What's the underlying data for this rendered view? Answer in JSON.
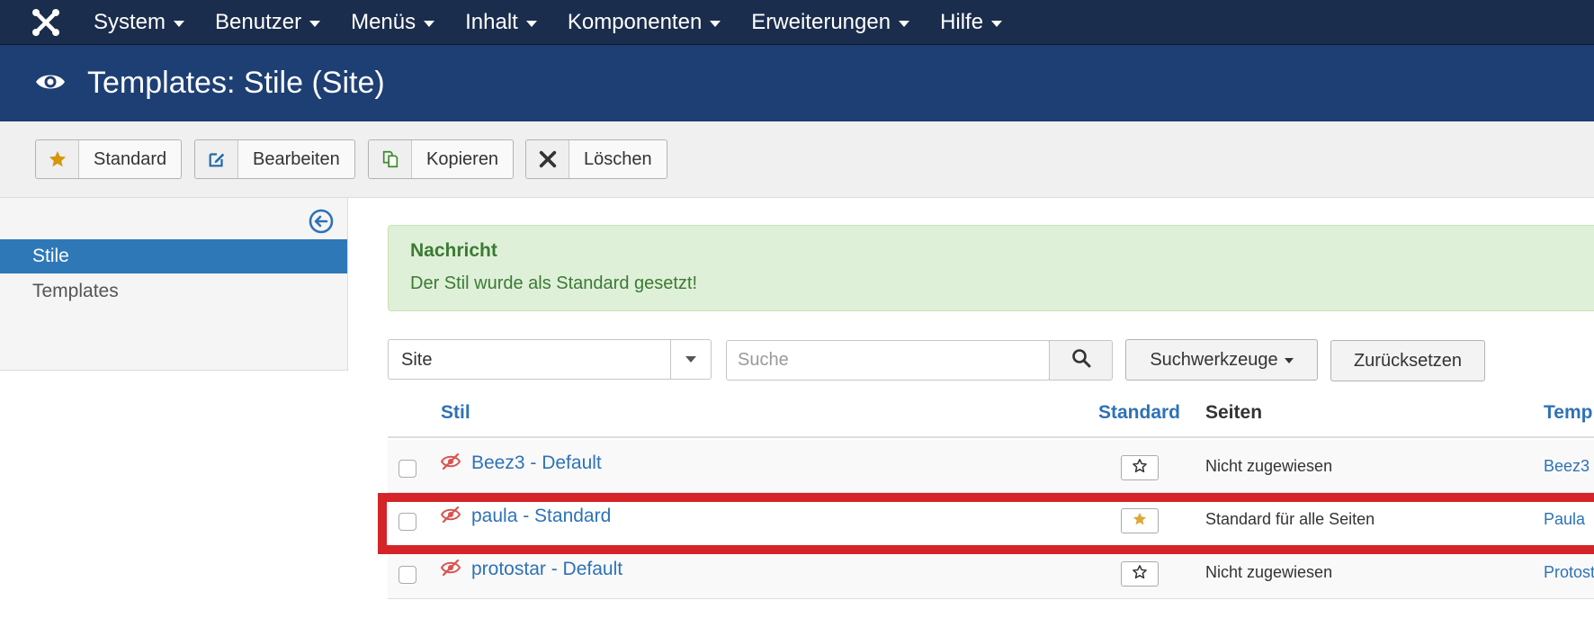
{
  "nav": {
    "items": [
      "System",
      "Benutzer",
      "Menüs",
      "Inhalt",
      "Komponenten",
      "Erweiterungen",
      "Hilfe"
    ]
  },
  "header": {
    "title": "Templates: Stile (Site)"
  },
  "toolbar": {
    "standard": "Standard",
    "edit": "Bearbeiten",
    "copy": "Kopieren",
    "delete": "Löschen"
  },
  "sidebar": {
    "items": [
      "Stile",
      "Templates"
    ]
  },
  "alert": {
    "heading": "Nachricht",
    "message": "Der Stil wurde als Standard gesetzt!"
  },
  "filters": {
    "client": "Site",
    "search_placeholder": "Suche",
    "search_tools": "Suchwerkzeuge",
    "reset": "Zurücksetzen"
  },
  "table": {
    "headers": {
      "style": "Stil",
      "default": "Standard",
      "pages": "Seiten",
      "template": "Temp"
    },
    "rows": [
      {
        "name": "Beez3 - Default",
        "is_default": false,
        "pages": "Nicht zugewiesen",
        "template": "Beez3"
      },
      {
        "name": "paula - Standard",
        "is_default": true,
        "pages": "Standard für alle Seiten",
        "template": "Paula"
      },
      {
        "name": "protostar - Default",
        "is_default": false,
        "pages": "Nicht zugewiesen",
        "template": "Protost"
      }
    ]
  },
  "colors": {
    "nav_bg": "#1b2d4c",
    "header_bg": "#1e3f73",
    "link": "#2e72b6",
    "alert_text": "#3b7a34",
    "star_gold": "#d4960c",
    "highlight": "#d42428"
  },
  "icons": {
    "logo": "joomla-logo-icon",
    "header": "eye-icon",
    "standard": "star-icon",
    "edit": "edit-icon",
    "copy": "copy-icon",
    "delete": "close-icon",
    "sidebar_toggle": "arrow-left-circle-icon",
    "search": "search-icon",
    "row_state": "eye-slash-icon"
  }
}
